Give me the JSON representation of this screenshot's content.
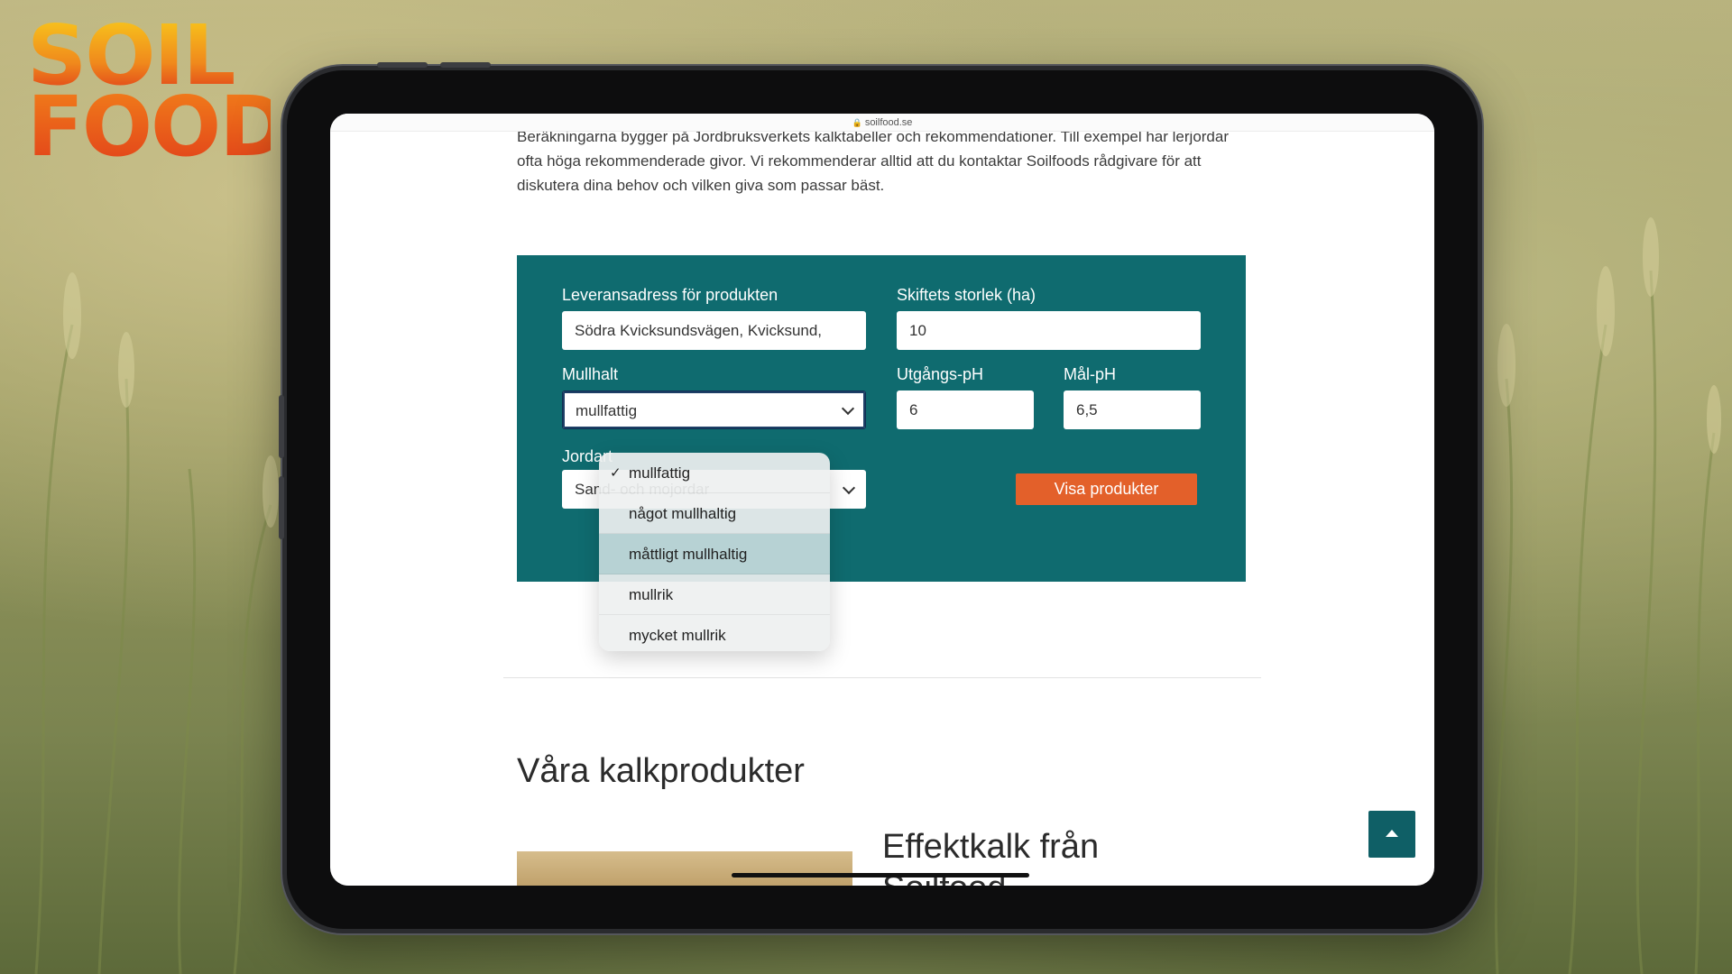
{
  "brand": {
    "logo_line1": "SOIL",
    "logo_line2": "FOOD"
  },
  "browser": {
    "url": "soilfood.se"
  },
  "intro": {
    "text": "Beräkningarna bygger på Jordbruksverkets kalktabeller och rekommendationer. Till exempel har lerjordar ofta höga rekommenderade givor. Vi rekommenderar alltid att du kontaktar Soilfoods rådgivare för att diskutera dina behov och vilken giva som passar bäst."
  },
  "form": {
    "address_label": "Leveransadress för produkten",
    "address_value": "Södra Kvicksundsvägen, Kvicksund,",
    "field_size_label": "Skiftets storlek (ha)",
    "field_size_value": "10",
    "mullhalt_label": "Mullhalt",
    "mullhalt_value": "mullfattig",
    "start_ph_label": "Utgångs-pH",
    "start_ph_value": "6",
    "target_ph_label": "Mål-pH",
    "target_ph_value": "6,5",
    "jordart_label": "Jordart",
    "jordart_value": "Sand- och mojordar",
    "submit_label": "Visa produkter"
  },
  "dropdown": {
    "options": [
      {
        "label": "mullfattig",
        "checked": true
      },
      {
        "label": "något mullhaltig",
        "checked": false
      },
      {
        "label": "måttligt mullhaltig",
        "checked": false,
        "highlighted": true
      },
      {
        "label": "mullrik",
        "checked": false
      },
      {
        "label": "mycket mullrik",
        "checked": false
      }
    ],
    "check_glyph": "✓"
  },
  "products": {
    "heading": "Våra kalkprodukter",
    "card_title_line1": "Effektkalk från",
    "card_title_line2": "Soilfood"
  },
  "colors": {
    "form_bg": "#0f6b6f",
    "button_bg": "#e3602a",
    "scrolltop_bg": "#0f5f66",
    "highlight": "#b7d2d4"
  }
}
